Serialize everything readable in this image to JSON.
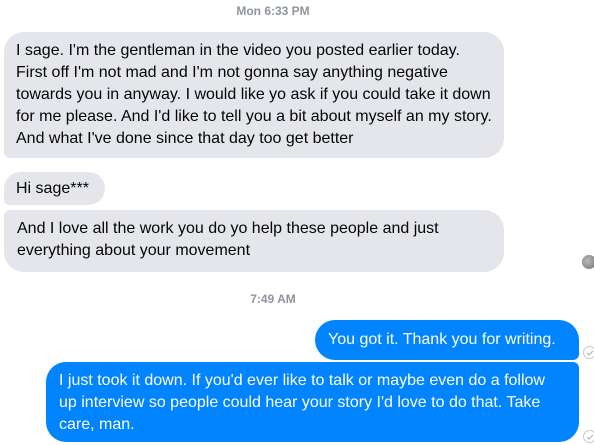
{
  "conversation": {
    "timestamp_1": "Mon 6:33 PM",
    "timestamp_2": "7:49 AM",
    "messages": [
      {
        "direction": "incoming",
        "text": "I sage. I'm the gentleman in the video you posted earlier today. First off I'm not mad and I'm not gonna say anything negative towards you in anyway. I would like yo ask if you could take it down for me please. And I'd like to tell you a bit about myself an my story. And what I've done since that day too get better"
      },
      {
        "direction": "incoming",
        "text": "Hi sage***"
      },
      {
        "direction": "incoming",
        "text": "And I love all the work you do yo help these people and just everything about your movement"
      },
      {
        "direction": "outgoing",
        "text": "You got it. Thank you for writing."
      },
      {
        "direction": "outgoing",
        "text": "I just took it down. If you'd ever like to talk or maybe even do a follow up interview so people could hear your story I'd love to do that. Take care, man."
      }
    ]
  },
  "colors": {
    "incoming_bubble": "#e4e6eb",
    "outgoing_bubble": "#0084ff",
    "timestamp": "#8d949e"
  },
  "icons": {
    "read_receipt": "avatar-icon",
    "sent_status": "check-circle-icon"
  }
}
